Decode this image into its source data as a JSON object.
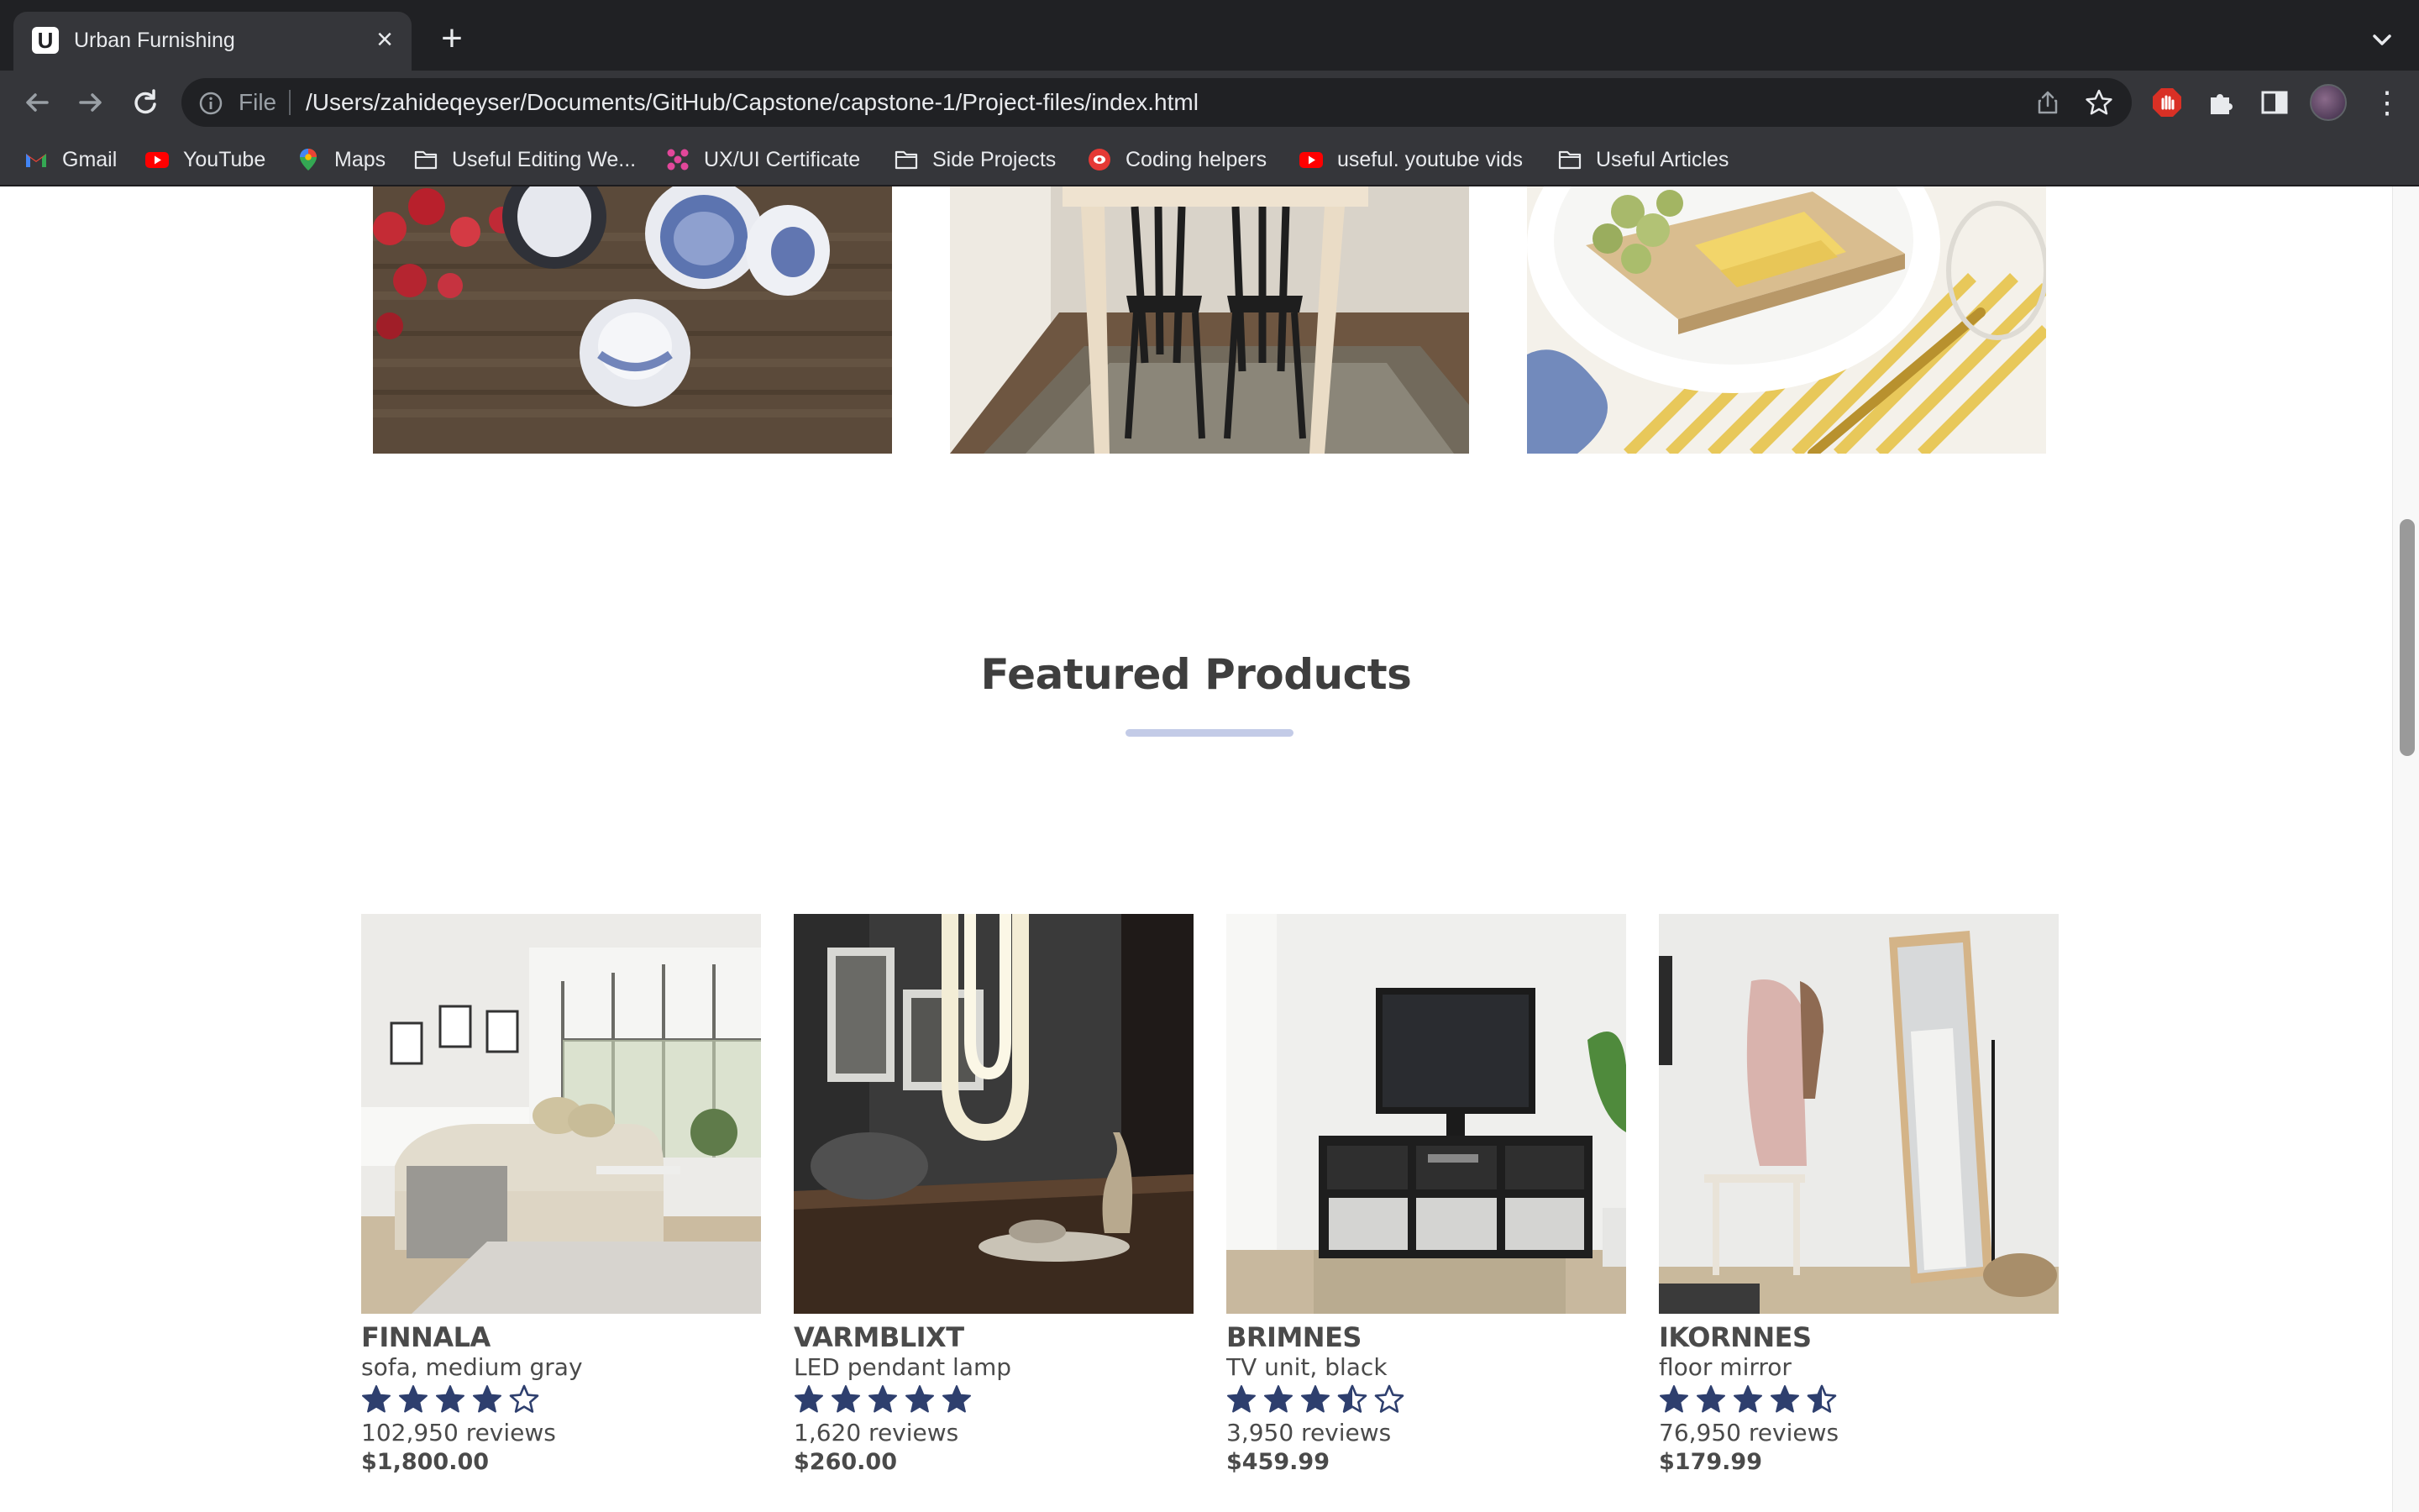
{
  "browser": {
    "tab_title": "Urban Furnishing",
    "tab_favicon_letter": "U",
    "omnibox_scheme": "File",
    "url": "/Users/zahideqeyser/Documents/GitHub/Capstone/capstone-1/Project-files/index.html",
    "bookmarks": [
      {
        "label": "Gmail",
        "icon": "gmail-icon"
      },
      {
        "label": "YouTube",
        "icon": "youtube-icon"
      },
      {
        "label": "Maps",
        "icon": "maps-icon"
      },
      {
        "label": "Useful Editing We...",
        "icon": "folder-icon"
      },
      {
        "label": "UX/UI Certificate",
        "icon": "dots-icon"
      },
      {
        "label": "Side Projects",
        "icon": "folder-icon"
      },
      {
        "label": "Coding helpers",
        "icon": "record-icon"
      },
      {
        "label": "useful. youtube vids",
        "icon": "youtube-icon"
      },
      {
        "label": "Useful Articles",
        "icon": "folder-icon"
      }
    ]
  },
  "page": {
    "featured_title": "Featured Products",
    "accent_color": "#c3cbe7",
    "star_color": "#2e3f6e",
    "products": [
      {
        "name": "FINNALA",
        "desc": "sofa, medium gray",
        "rating": 4,
        "reviews": "102,950 reviews",
        "price": "$1,800.00"
      },
      {
        "name": "VARMBLIXT",
        "desc": "LED pendant lamp",
        "rating": 5,
        "reviews": "1,620 reviews",
        "price": "$260.00"
      },
      {
        "name": "BRIMNES",
        "desc": "TV unit, black",
        "rating": 3.5,
        "reviews": "3,950 reviews",
        "price": "$459.99"
      },
      {
        "name": "IKORNNES",
        "desc": "floor mirror",
        "rating": 4.5,
        "reviews": "76,950 reviews",
        "price": "$179.99"
      }
    ]
  }
}
